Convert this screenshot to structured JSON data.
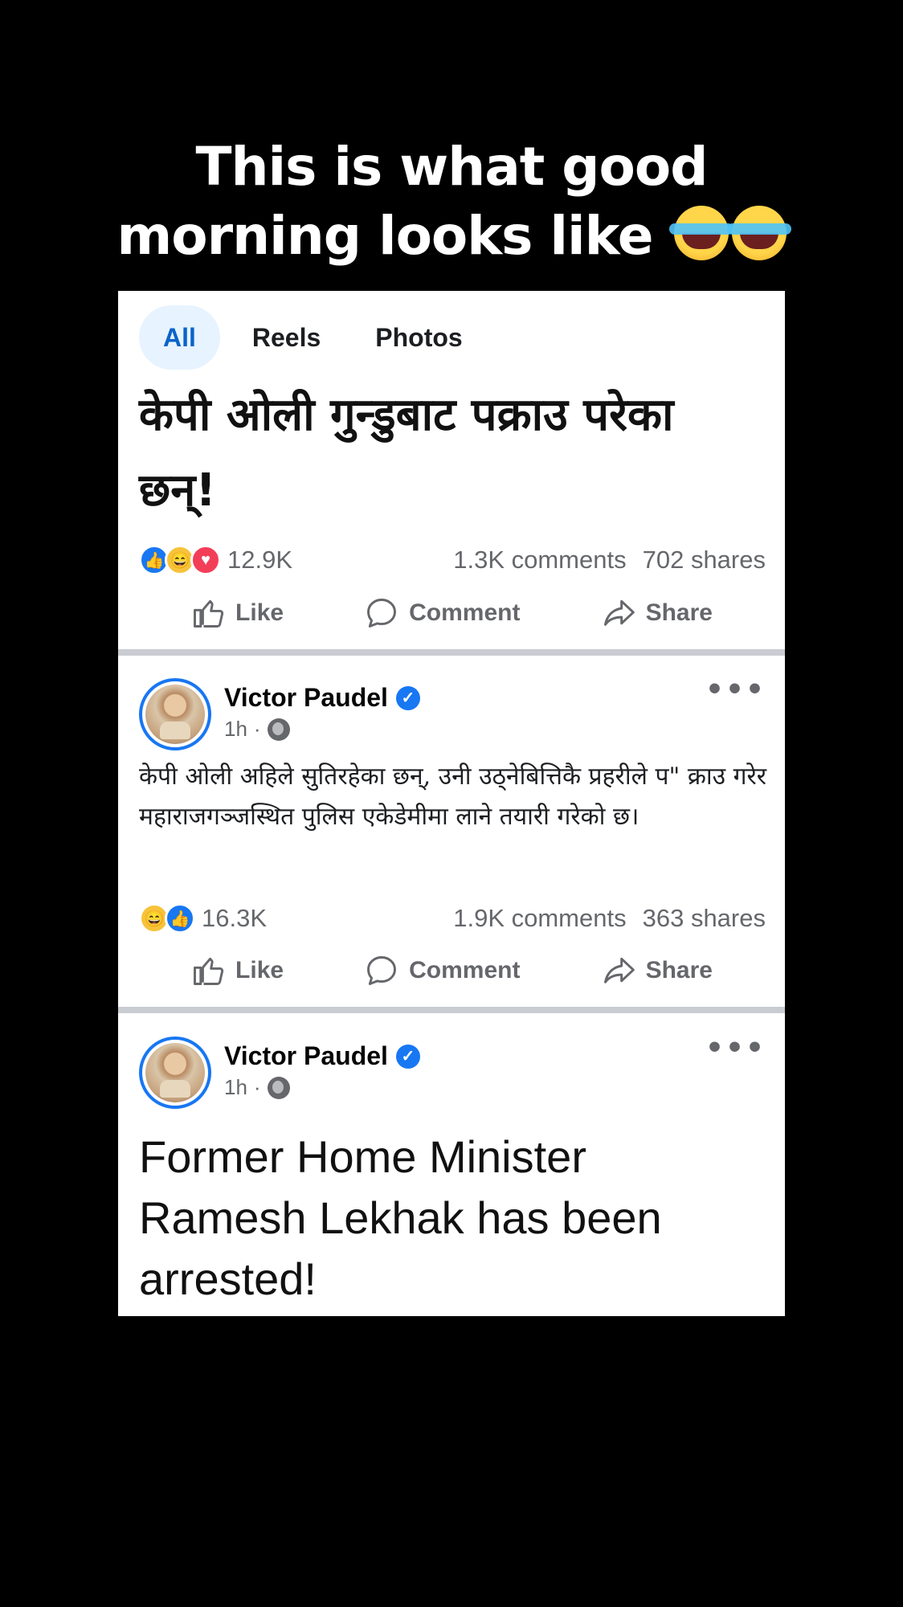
{
  "caption": {
    "line1": "This is what good",
    "line2": "morning looks like"
  },
  "tabs": [
    {
      "label": "All",
      "active": true
    },
    {
      "label": "Reels",
      "active": false
    },
    {
      "label": "Photos",
      "active": false
    }
  ],
  "posts": [
    {
      "text": "केपी ओली गुन्डुबाट पक्राउ परेका छन्!",
      "reactions": [
        "like",
        "haha",
        "love"
      ],
      "reaction_count": "12.9K",
      "comments": "1.3K comments",
      "shares": "702 shares"
    },
    {
      "author": "Victor Paudel",
      "time": "1h",
      "text": "केपी ओली अहिले सुतिरहेका छन्, उनी उठ्नेबित्तिकै प्रहरीले प\" क्राउ गरेर महाराजगञ्जस्थित पुलिस एकेडेमीमा लाने तयारी गरेको छ।",
      "reactions": [
        "haha",
        "like"
      ],
      "reaction_count": "16.3K",
      "comments": "1.9K comments",
      "shares": "363 shares"
    },
    {
      "author": "Victor Paudel",
      "time": "1h",
      "text": "Former Home Minister Ramesh Lekhak has been arrested!"
    }
  ],
  "actions": {
    "like": "Like",
    "comment": "Comment",
    "share": "Share"
  },
  "colors": {
    "accent": "#1877f2",
    "tab_active_bg": "#e7f3ff",
    "divider": "#c9ccd1",
    "muted": "#65676b"
  }
}
